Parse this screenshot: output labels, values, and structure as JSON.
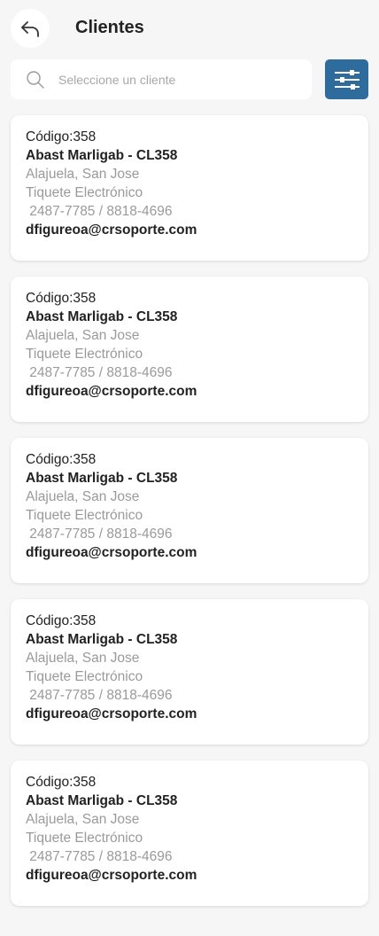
{
  "header": {
    "title": "Clientes"
  },
  "search": {
    "placeholder": "Seleccione un cliente",
    "value": ""
  },
  "icons": {
    "back": "back-arrow-icon",
    "search": "search-icon",
    "filter": "sliders-icon"
  },
  "colors": {
    "accent": "#2f6c9e"
  },
  "clients": [
    {
      "code": "Código:358",
      "name": "Abast Marligab - CL358",
      "address": "Alajuela, San Jose",
      "doc_type": "Tiquete Electrónico",
      "phones": " 2487-7785 / 8818-4696",
      "email": "dfigureoa@crsoporte.com"
    },
    {
      "code": "Código:358",
      "name": "Abast Marligab - CL358",
      "address": "Alajuela, San Jose",
      "doc_type": "Tiquete Electrónico",
      "phones": " 2487-7785 / 8818-4696",
      "email": "dfigureoa@crsoporte.com"
    },
    {
      "code": "Código:358",
      "name": "Abast Marligab - CL358",
      "address": "Alajuela, San Jose",
      "doc_type": "Tiquete Electrónico",
      "phones": " 2487-7785 / 8818-4696",
      "email": "dfigureoa@crsoporte.com"
    },
    {
      "code": "Código:358",
      "name": "Abast Marligab - CL358",
      "address": "Alajuela, San Jose",
      "doc_type": "Tiquete Electrónico",
      "phones": " 2487-7785 / 8818-4696",
      "email": "dfigureoa@crsoporte.com"
    },
    {
      "code": "Código:358",
      "name": "Abast Marligab - CL358",
      "address": "Alajuela, San Jose",
      "doc_type": "Tiquete Electrónico",
      "phones": " 2487-7785 / 8818-4696",
      "email": "dfigureoa@crsoporte.com"
    }
  ]
}
